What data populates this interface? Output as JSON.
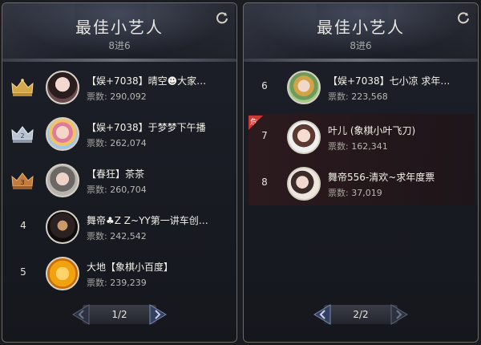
{
  "colors": {
    "accent_gold": "#d4a84a",
    "selected_bg": "#2d1a1e",
    "danger": "#cc3b35"
  },
  "panels": [
    {
      "title": "最佳小艺人",
      "subtitle": "8进6",
      "refresh_icon": "refresh-icon",
      "rows": [
        {
          "rank": "1",
          "rank_badge": "gold-crown-icon",
          "name": "【娱+7038】晴空☻大家…",
          "votes_label": "票数:",
          "votes": "290,092"
        },
        {
          "rank": "2",
          "rank_badge": "silver-crown-icon",
          "name": "【娱+7038】于梦梦下午播",
          "votes_label": "票数:",
          "votes": "262,074"
        },
        {
          "rank": "3",
          "rank_badge": "bronze-crown-icon",
          "name": "【春狂】茶茶",
          "votes_label": "票数:",
          "votes": "260,704"
        },
        {
          "rank": "4",
          "rank_badge": "",
          "name": "舞帝♣Z Z~YY第一讲车创…",
          "votes_label": "票数:",
          "votes": "242,542"
        },
        {
          "rank": "5",
          "rank_badge": "",
          "name": "大地【象棋小百度】",
          "votes_label": "票数:",
          "votes": "239,239"
        }
      ],
      "pager": {
        "label": "1/2"
      }
    },
    {
      "title": "最佳小艺人",
      "subtitle": "8进6",
      "refresh_icon": "refresh-icon",
      "rows": [
        {
          "rank": "6",
          "rank_badge": "",
          "name": "【娱+7038】七小凉 求年…",
          "votes_label": "票数:",
          "votes": "223,568"
        },
        {
          "rank": "7",
          "rank_badge": "danger-corner-badge",
          "danger_text": "危",
          "name": "叶儿 (象棋小叶飞刀)",
          "votes_label": "票数:",
          "votes": "162,341"
        },
        {
          "rank": "8",
          "rank_badge": "",
          "name": "舞帝556-清欢~求年度票",
          "votes_label": "票数:",
          "votes": "37,019"
        }
      ],
      "pager": {
        "label": "2/2"
      }
    }
  ]
}
